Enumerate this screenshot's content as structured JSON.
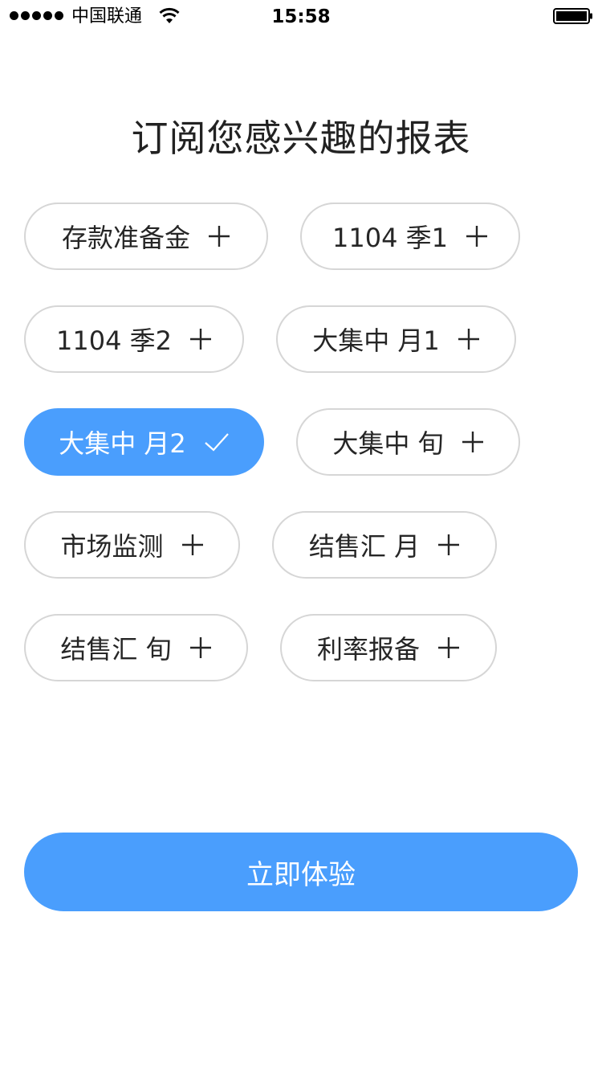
{
  "status_bar": {
    "carrier": "中国联通",
    "time": "15:58"
  },
  "title": "订阅您感兴趣的报表",
  "chips": [
    {
      "label": "存款准备金",
      "selected": false
    },
    {
      "label": "1104 季1",
      "selected": false
    },
    {
      "label": "1104 季2",
      "selected": false
    },
    {
      "label": "大集中 月1",
      "selected": false
    },
    {
      "label": "大集中 月2",
      "selected": true
    },
    {
      "label": "大集中 旬",
      "selected": false
    },
    {
      "label": "市场监测",
      "selected": false
    },
    {
      "label": "结售汇 月",
      "selected": false
    },
    {
      "label": "结售汇 旬",
      "selected": false
    },
    {
      "label": "利率报备",
      "selected": false
    }
  ],
  "cta_label": "立即体验",
  "colors": {
    "accent": "#4a9efd",
    "chip_border": "#d6d6d6"
  }
}
